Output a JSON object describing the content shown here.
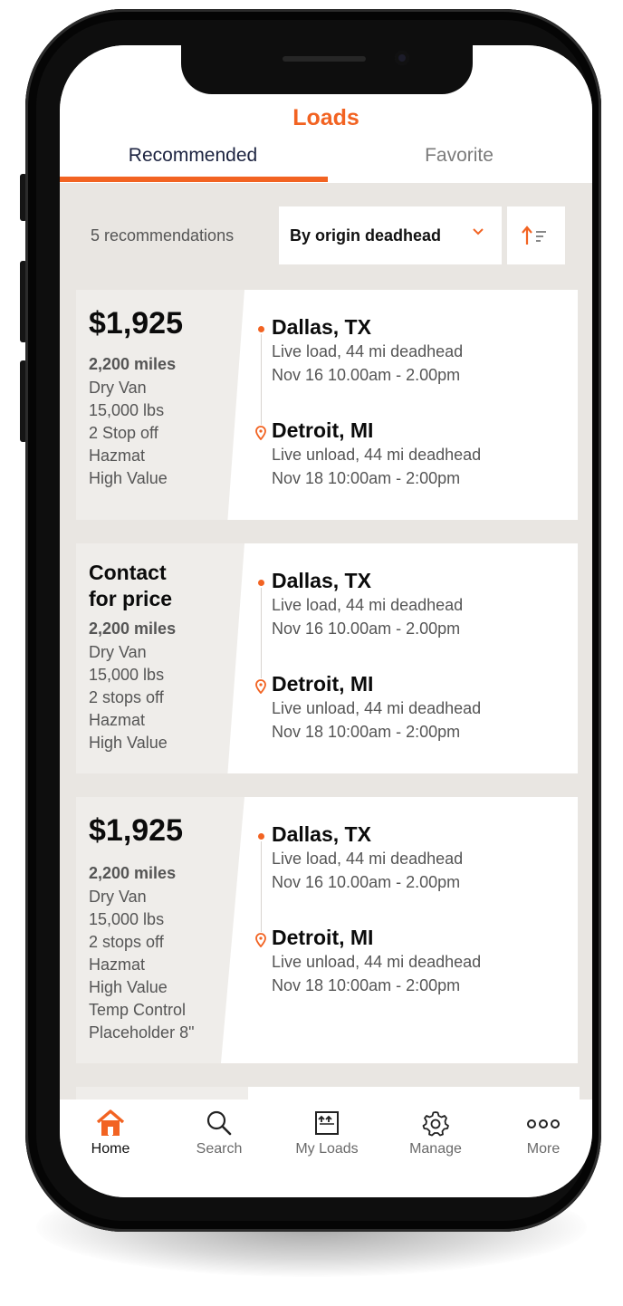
{
  "colors": {
    "accent": "#f26322",
    "tab_active": "#1c2340",
    "muted_text": "#555555"
  },
  "header": {
    "title": "Loads",
    "tabs": [
      {
        "label": "Recommended",
        "active": true
      },
      {
        "label": "Favorite",
        "active": false
      }
    ]
  },
  "toolbar": {
    "count_label": "5 recommendations",
    "sort_selected": "By origin deadhead",
    "sort_caret_icon": "chevron-down-icon",
    "sort_order_icon": "sort-ascending-icon"
  },
  "loads": [
    {
      "price": "$1,925",
      "miles": "2,200 miles",
      "specs": [
        "Dry Van",
        "15,000 lbs",
        "2 Stop off",
        "Hazmat",
        "High Value"
      ],
      "origin": {
        "city": "Dallas, TX",
        "detail": "Live load, 44 mi deadhead",
        "time": "Nov 16  10.00am - 2.00pm"
      },
      "destination": {
        "city": "Detroit, MI",
        "detail": "Live unload, 44 mi deadhead",
        "time": "Nov 18  10:00am - 2:00pm"
      }
    },
    {
      "price_line1": "Contact",
      "price_line2": "for price",
      "miles": "2,200 miles",
      "specs": [
        "Dry Van",
        "15,000 lbs",
        "2 stops off",
        "Hazmat",
        "High Value"
      ],
      "origin": {
        "city": "Dallas, TX",
        "detail": "Live load, 44 mi deadhead",
        "time": "Nov 16  10.00am - 2.00pm"
      },
      "destination": {
        "city": "Detroit, MI",
        "detail": "Live unload, 44 mi deadhead",
        "time": "Nov 18  10:00am - 2:00pm"
      }
    },
    {
      "price": "$1,925",
      "miles": "2,200 miles",
      "specs": [
        "Dry Van",
        "15,000 lbs",
        "2 stops off",
        "Hazmat",
        "High Value",
        "Temp Control",
        "Placeholder 8\""
      ],
      "origin": {
        "city": "Dallas, TX",
        "detail": "Live load, 44 mi deadhead",
        "time": "Nov 16  10.00am - 2.00pm"
      },
      "destination": {
        "city": "Detroit, MI",
        "detail": "Live unload, 44 mi deadhead",
        "time": "Nov 18  10:00am - 2:00pm"
      }
    }
  ],
  "nav": [
    {
      "label": "Home",
      "icon": "home-icon",
      "active": true
    },
    {
      "label": "Search",
      "icon": "search-icon",
      "active": false
    },
    {
      "label": "My Loads",
      "icon": "my-loads-icon",
      "active": false
    },
    {
      "label": "Manage",
      "icon": "gear-icon",
      "active": false
    },
    {
      "label": "More",
      "icon": "more-dots-icon",
      "active": false
    }
  ]
}
